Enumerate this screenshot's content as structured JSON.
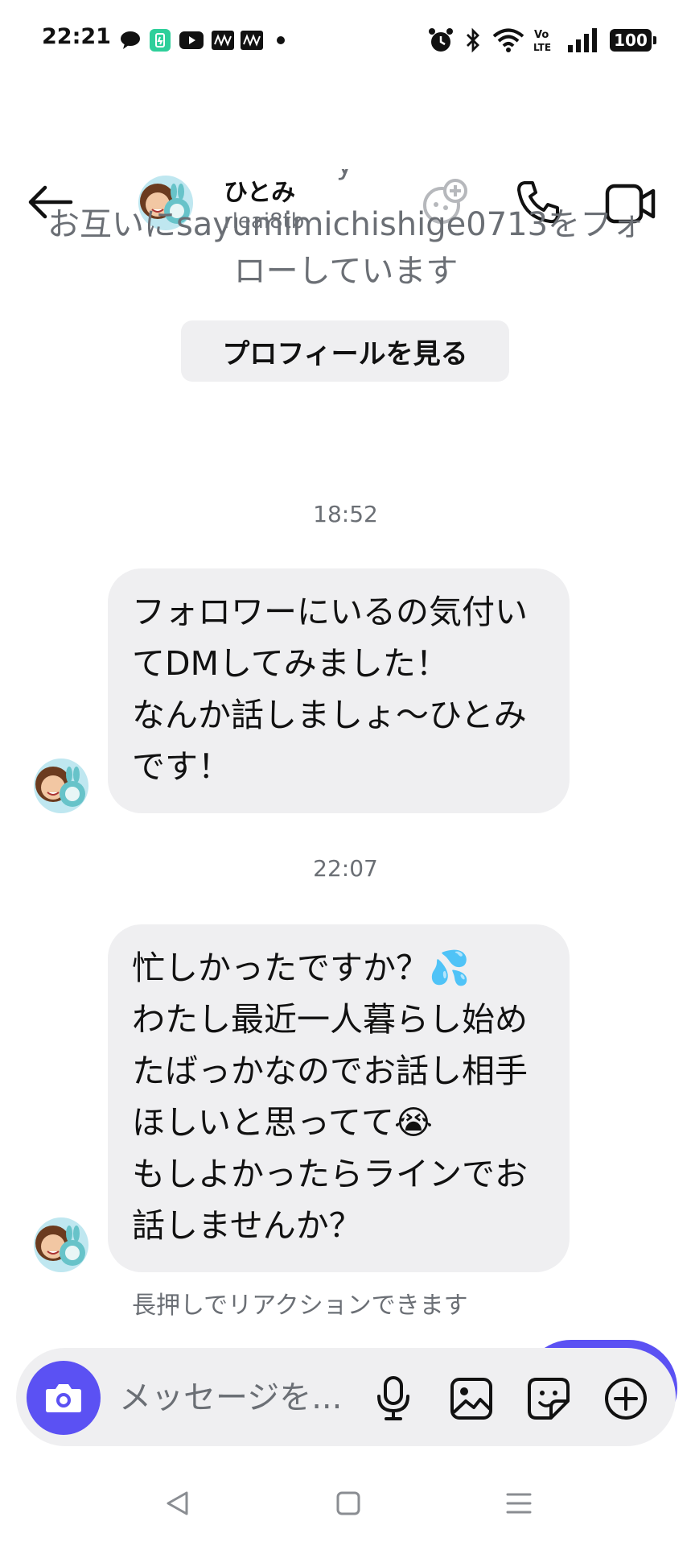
{
  "status_bar": {
    "time": "22:21",
    "battery": "100",
    "left_icons": [
      "chat-bubble-icon",
      "battery-saver-icon",
      "youtube-icon",
      "app-icon",
      "app-icon",
      "dot-icon"
    ],
    "right_icons": [
      "alarm-icon",
      "bluetooth-icon",
      "wifi-icon",
      "volte-icon",
      "signal-icon",
      "battery-icon"
    ]
  },
  "header": {
    "name": "ひとみ",
    "username": "rleai8tb",
    "icons": [
      "back-arrow-icon",
      "add-game-icon",
      "phone-icon",
      "video-icon"
    ]
  },
  "intro": {
    "mutual_line1": "お互いにsayumimichishige0713をフォ",
    "mutual_line2": "ローしています",
    "profile_button": "プロフィールを見る"
  },
  "messages": [
    {
      "timestamp": "18:52",
      "text": "フォロワーにいるの気付い\nてDMしてみました！\nなんか話しましょ〜ひとみ\nです！"
    },
    {
      "timestamp": "22:07",
      "text": "忙しかったですか？💦\nわたし最近一人暮らし始め\nたばっかなのでお話し相手\nほしいと思ってて😭\nもしよかったらラインでお\n話しませんか？"
    }
  ],
  "reaction_hint": "長押しでリアクションできます",
  "composer": {
    "placeholder": "メッセージを...",
    "icons": [
      "camera-icon",
      "microphone-icon",
      "image-icon",
      "sticker-icon",
      "add-icon"
    ],
    "accent": "#5b51f3"
  },
  "colors": {
    "bubble": "#efeff1",
    "secondary_text": "#6b6f75",
    "accent": "#5b51f3"
  }
}
